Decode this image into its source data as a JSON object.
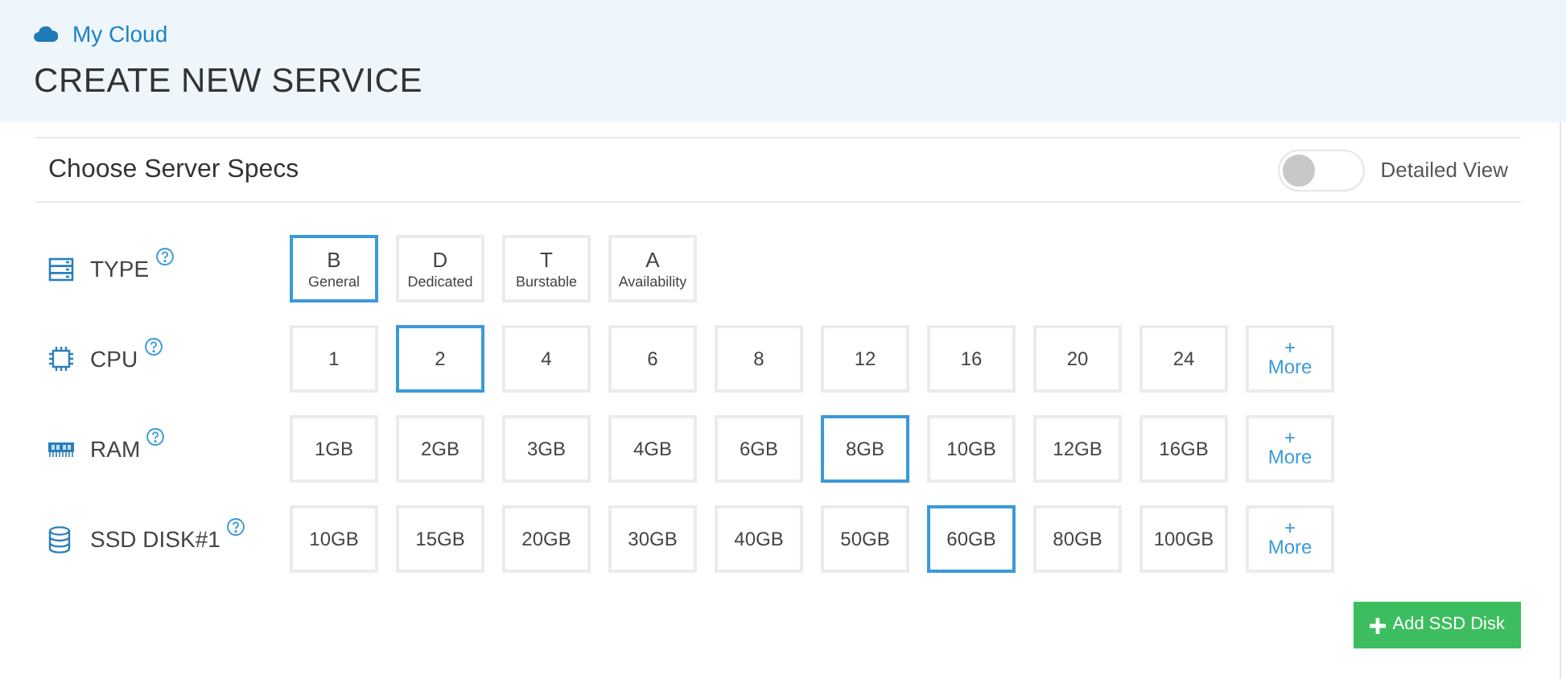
{
  "breadcrumb": "My Cloud",
  "page_title": "CREATE NEW SERVICE",
  "section": {
    "title": "Choose Server Specs",
    "toggle": {
      "label": "Detailed View",
      "on": false
    }
  },
  "specs": [
    {
      "label": "TYPE",
      "kind": "type",
      "options": [
        {
          "kind": "type",
          "letter": "B",
          "label": "General",
          "selected": true
        },
        {
          "kind": "type",
          "letter": "D",
          "label": "Dedicated",
          "selected": false
        },
        {
          "kind": "type",
          "letter": "T",
          "label": "Burstable",
          "selected": false
        },
        {
          "kind": "type",
          "letter": "A",
          "label": "Availability",
          "selected": false
        }
      ]
    },
    {
      "label": "CPU",
      "kind": "cpu",
      "options": [
        {
          "kind": "value",
          "label": "1",
          "selected": false
        },
        {
          "kind": "value",
          "label": "2",
          "selected": true
        },
        {
          "kind": "value",
          "label": "4",
          "selected": false
        },
        {
          "kind": "value",
          "label": "6",
          "selected": false
        },
        {
          "kind": "value",
          "label": "8",
          "selected": false
        },
        {
          "kind": "value",
          "label": "12",
          "selected": false
        },
        {
          "kind": "value",
          "label": "16",
          "selected": false
        },
        {
          "kind": "value",
          "label": "20",
          "selected": false
        },
        {
          "kind": "value",
          "label": "24",
          "selected": false
        },
        {
          "kind": "more",
          "symbol": "+",
          "label": "More",
          "selected": false
        }
      ]
    },
    {
      "label": "RAM",
      "kind": "ram",
      "options": [
        {
          "kind": "value",
          "label": "1GB",
          "selected": false
        },
        {
          "kind": "value",
          "label": "2GB",
          "selected": false
        },
        {
          "kind": "value",
          "label": "3GB",
          "selected": false
        },
        {
          "kind": "value",
          "label": "4GB",
          "selected": false
        },
        {
          "kind": "value",
          "label": "6GB",
          "selected": false
        },
        {
          "kind": "value",
          "label": "8GB",
          "selected": true
        },
        {
          "kind": "value",
          "label": "10GB",
          "selected": false
        },
        {
          "kind": "value",
          "label": "12GB",
          "selected": false
        },
        {
          "kind": "value",
          "label": "16GB",
          "selected": false
        },
        {
          "kind": "more",
          "symbol": "+",
          "label": "More",
          "selected": false
        }
      ]
    },
    {
      "label": "SSD DISK#1",
      "kind": "disk",
      "options": [
        {
          "kind": "value",
          "label": "10GB",
          "selected": false
        },
        {
          "kind": "value",
          "label": "15GB",
          "selected": false
        },
        {
          "kind": "value",
          "label": "20GB",
          "selected": false
        },
        {
          "kind": "value",
          "label": "30GB",
          "selected": false
        },
        {
          "kind": "value",
          "label": "40GB",
          "selected": false
        },
        {
          "kind": "value",
          "label": "50GB",
          "selected": false
        },
        {
          "kind": "value",
          "label": "60GB",
          "selected": true
        },
        {
          "kind": "value",
          "label": "80GB",
          "selected": false
        },
        {
          "kind": "value",
          "label": "100GB",
          "selected": false
        },
        {
          "kind": "more",
          "symbol": "+",
          "label": "More",
          "selected": false
        }
      ]
    }
  ],
  "add_button": "Add SSD Disk"
}
